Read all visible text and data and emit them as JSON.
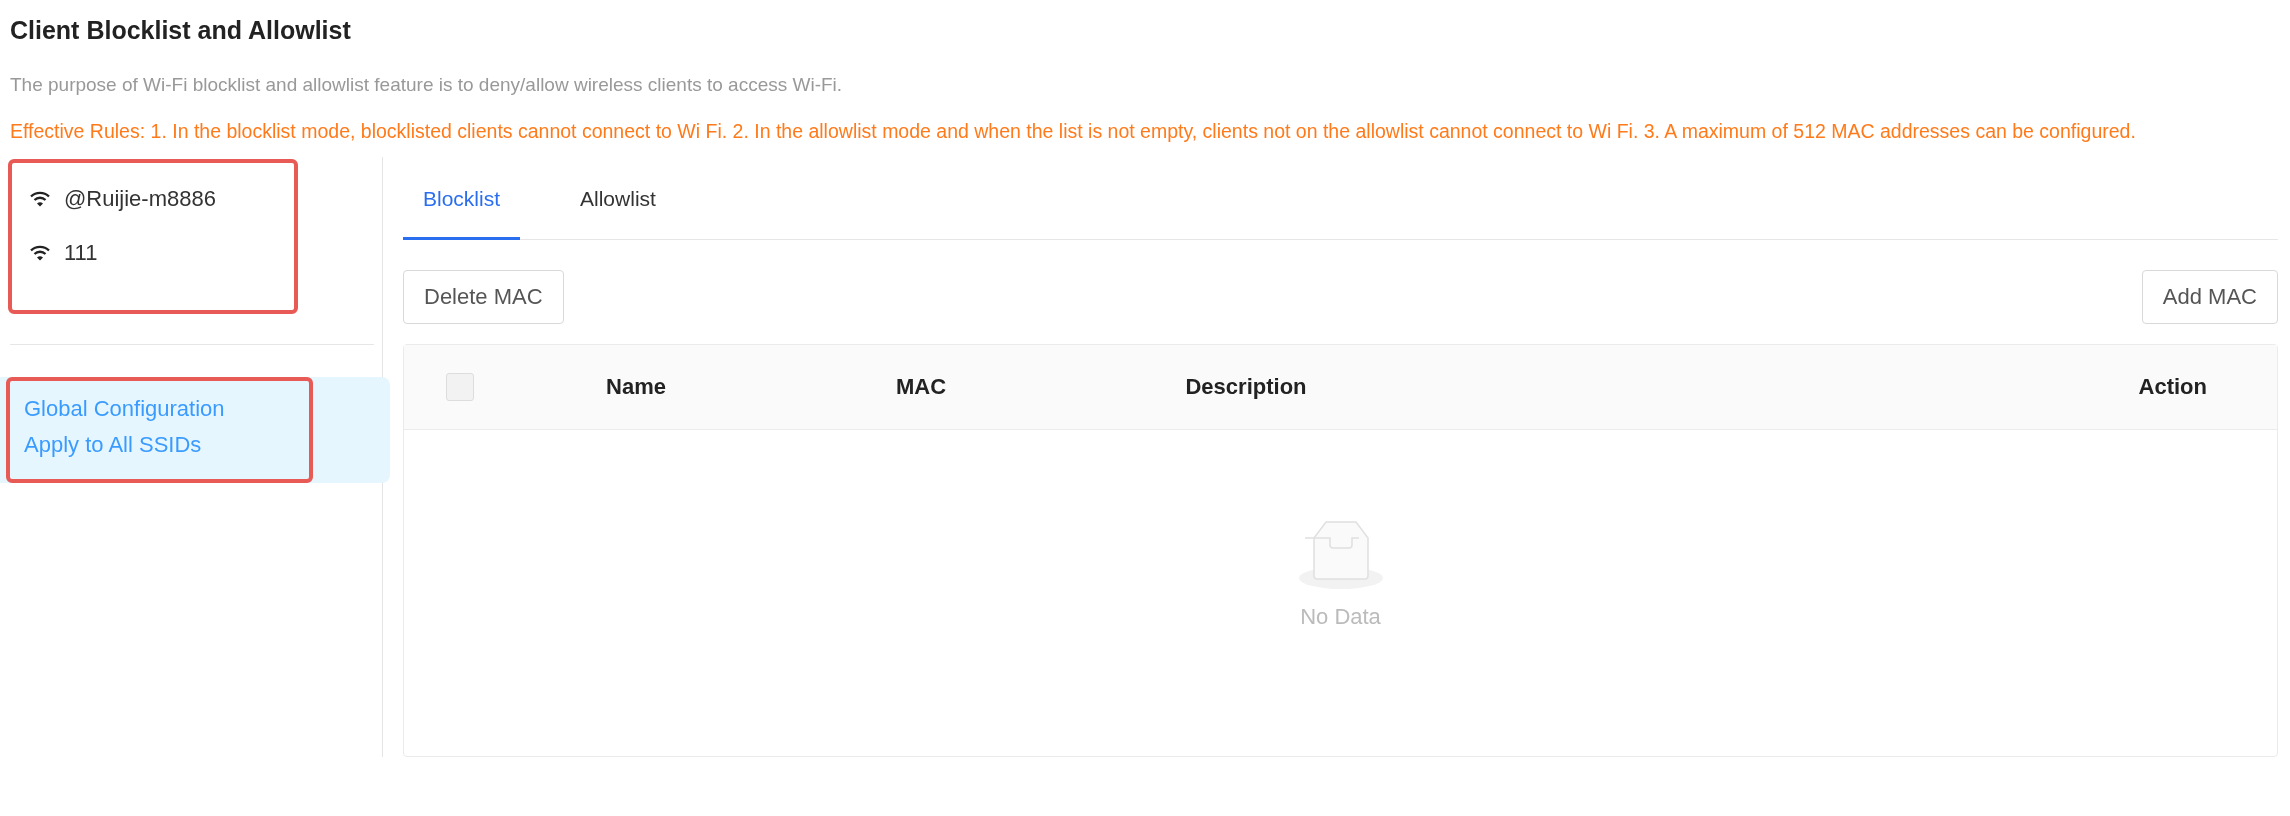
{
  "page": {
    "title": "Client Blocklist and Allowlist",
    "description": "The purpose of Wi-Fi blocklist and allowlist feature is to deny/allow wireless clients to access Wi-Fi.",
    "rules": "Effective Rules: 1. In the blocklist mode, blocklisted clients cannot connect to Wi Fi. 2. In the allowlist mode and when the list is not empty, clients not on the allowlist cannot connect to Wi Fi. 3. A maximum of 512 MAC addresses can be configured."
  },
  "sidebar": {
    "ssids": [
      {
        "label": "@Ruijie-m8886",
        "selected": false
      },
      {
        "label": "111",
        "selected": false
      }
    ],
    "global": {
      "lines": [
        "Global Configuration",
        "Apply to All SSIDs"
      ],
      "selected": true
    }
  },
  "tabs": [
    {
      "label": "Blocklist",
      "selected": true
    },
    {
      "label": "Allowlist",
      "selected": false
    }
  ],
  "toolbar": {
    "delete_button": "Delete MAC",
    "add_button": "Add MAC"
  },
  "table": {
    "select_all_checked": false,
    "columns": [
      "Name",
      "MAC",
      "Description",
      "Action"
    ],
    "empty_text": "No Data"
  }
}
